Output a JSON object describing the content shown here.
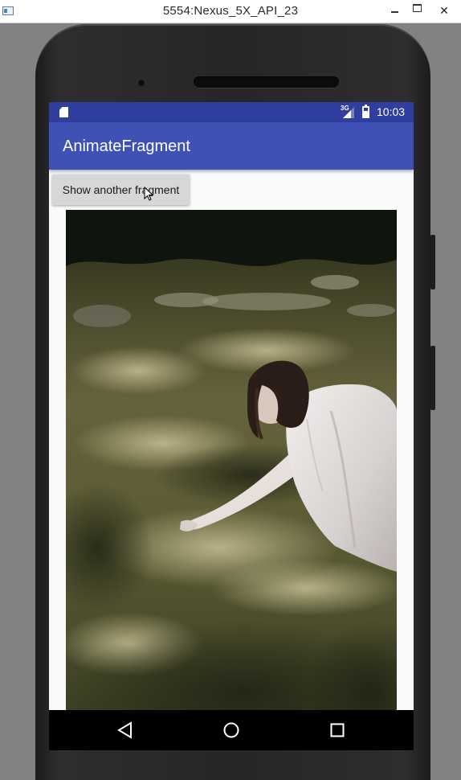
{
  "window": {
    "title": "5554:Nexus_5X_API_23",
    "minimize_glyph": "—",
    "close_glyph": "✕"
  },
  "statusbar": {
    "network_label": "3G",
    "time": "10:03",
    "icons": [
      "sd-card-icon",
      "signal-icon",
      "battery-icon"
    ]
  },
  "appbar": {
    "title": "AnimateFragment"
  },
  "content": {
    "button_label": "Show another fragment",
    "image": {
      "semantic": "photo of a woman in a white dress reaching across a sun-dappled grassy ground",
      "colors": {
        "grass_dark": "#2c3018",
        "grass_mid": "#5b5c33",
        "sunlight": "#b8b286",
        "dress": "#dcd8d6",
        "hair": "#2a1c16"
      }
    }
  },
  "navbar": {
    "buttons": [
      "back-icon",
      "home-icon",
      "recents-icon"
    ]
  },
  "colors": {
    "primary": "#3f51b5",
    "primary_dark": "#303f9f",
    "screen_bg": "#fafafa",
    "button_bg": "#d6d7d7",
    "emulator_bg": "#828282"
  }
}
